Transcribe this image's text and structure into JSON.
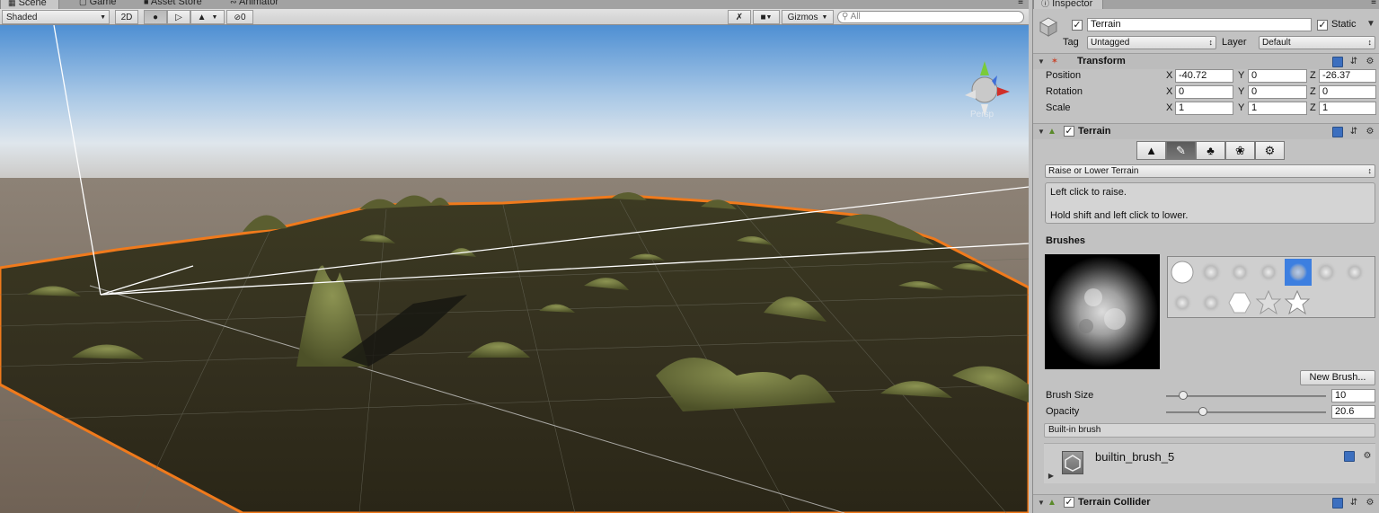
{
  "tabs": [
    {
      "label": "Scene",
      "icon": "scene-icon",
      "active": true
    },
    {
      "label": "Game",
      "icon": "game-icon",
      "active": false
    },
    {
      "label": "Asset Store",
      "icon": "store-icon",
      "active": false
    },
    {
      "label": "Animator",
      "icon": "animator-icon",
      "active": false
    }
  ],
  "toolbar": {
    "shading_mode": "Shaded",
    "mode_2d": "2D",
    "hidden_count": "0",
    "gizmos_label": "Gizmos",
    "search_placeholder": "All"
  },
  "scene": {
    "projection_label": "Persp",
    "selection_outline_color": "#f07a1c"
  },
  "inspector": {
    "tab_label": "Inspector",
    "object_name": "Terrain",
    "static_label": "Static",
    "tag_label": "Tag",
    "tag_value": "Untagged",
    "layer_label": "Layer",
    "layer_value": "Default",
    "transform": {
      "title": "Transform",
      "position_label": "Position",
      "rotation_label": "Rotation",
      "scale_label": "Scale",
      "position": {
        "x": "-40.72",
        "y": "0",
        "z": "-26.37"
      },
      "rotation": {
        "x": "0",
        "y": "0",
        "z": "0"
      },
      "scale": {
        "x": "1",
        "y": "1",
        "z": "1"
      },
      "axis_x": "X",
      "axis_y": "Y",
      "axis_z": "Z"
    },
    "terrain": {
      "title": "Terrain",
      "tool_dropdown": "Raise or Lower Terrain",
      "help_line1": "Left click to raise.",
      "help_line2": "Hold shift and left click to lower.",
      "brushes_label": "Brushes",
      "new_brush_button": "New Brush...",
      "brush_size_label": "Brush Size",
      "brush_size_value": "10",
      "brush_size_fraction": 0.08,
      "opacity_label": "Opacity",
      "opacity_value": "20.6",
      "opacity_fraction": 0.2,
      "builtin_label": "Built-in brush",
      "brush_asset_name": "builtin_brush_5"
    },
    "terrain_collider": {
      "title": "Terrain Collider"
    },
    "accent_color": "#3d7fe0"
  }
}
